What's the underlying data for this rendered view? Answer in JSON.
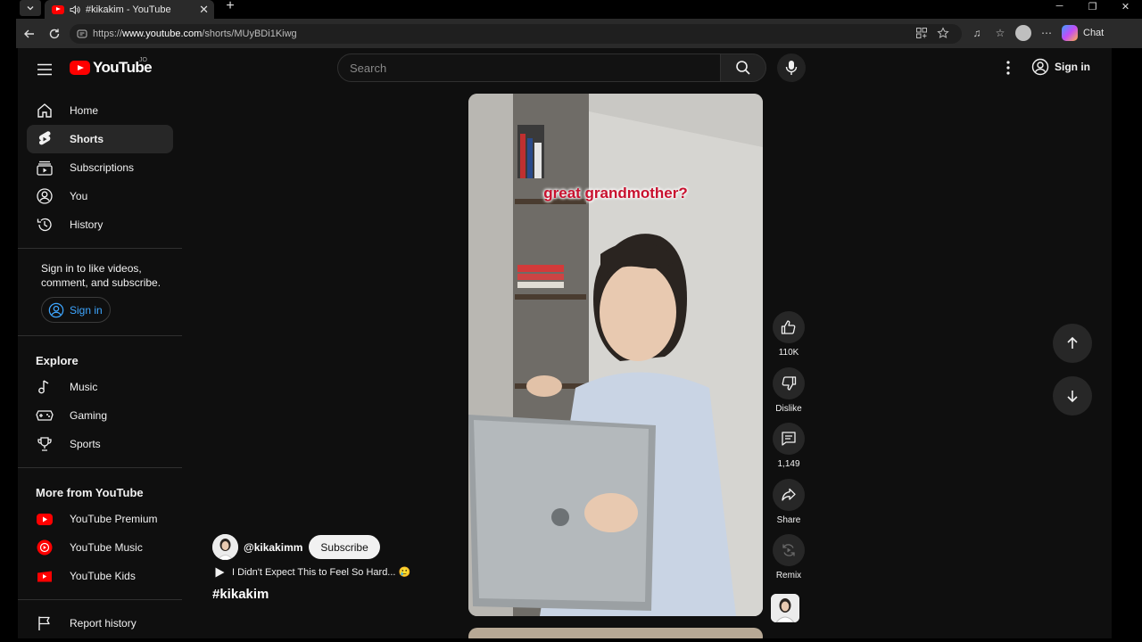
{
  "browser": {
    "tab_title": "#kikakim - YouTube",
    "new_tab": "+",
    "url_prefix": "https://",
    "url_host": "www.youtube.com",
    "url_path": "/shorts/MUyBDi1Kiwg",
    "chat_label": "Chat"
  },
  "masthead": {
    "logo_text": "YouTube",
    "country_code": "JO",
    "search_placeholder": "Search",
    "signin_label": "Sign in"
  },
  "sidebar": {
    "main_items": [
      {
        "label": "Home",
        "icon": "home-icon"
      },
      {
        "label": "Shorts",
        "icon": "shorts-icon",
        "active": true
      },
      {
        "label": "Subscriptions",
        "icon": "subscriptions-icon"
      },
      {
        "label": "You",
        "icon": "you-icon"
      },
      {
        "label": "History",
        "icon": "history-icon"
      }
    ],
    "signin_prompt": "Sign in to like videos, comment, and subscribe.",
    "signin_button": "Sign in",
    "explore_heading": "Explore",
    "explore_items": [
      {
        "label": "Music",
        "icon": "music-icon"
      },
      {
        "label": "Gaming",
        "icon": "gaming-icon"
      },
      {
        "label": "Sports",
        "icon": "trophy-icon"
      }
    ],
    "more_heading": "More from YouTube",
    "more_items": [
      {
        "label": "YouTube Premium",
        "icon": "youtube-premium-icon"
      },
      {
        "label": "YouTube Music",
        "icon": "youtube-music-icon"
      },
      {
        "label": "YouTube Kids",
        "icon": "youtube-kids-icon"
      }
    ],
    "report_history": "Report history"
  },
  "short": {
    "caption": "great grandmother?",
    "channel_handle": "@kikakimm",
    "subscribe_label": "Subscribe",
    "audio_title": "I Didn't Expect This to Feel So Hard... 🥲",
    "hashtag": "#kikakim"
  },
  "actions": {
    "like_count": "110K",
    "dislike_label": "Dislike",
    "comment_count": "1,149",
    "share_label": "Share",
    "remix_label": "Remix"
  },
  "colors": {
    "brand_red": "#ff0000",
    "link_blue": "#3ea6ff",
    "page_bg": "#0f0f0f",
    "caption_red": "#c8102e"
  }
}
